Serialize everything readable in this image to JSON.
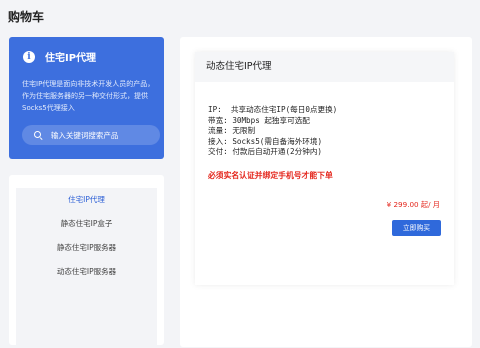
{
  "page": {
    "title": "购物车"
  },
  "hero": {
    "icon": "info-icon",
    "title": "住宅IP代理",
    "description": "住宅IP代理是面向非技术开发人员的产品，作为住宅服务器的另一种交付形式，提供Socks5代理接入",
    "search_placeholder": "输入关键词搜索产品",
    "color": "#3d6fde"
  },
  "categories": [
    {
      "label": "住宅IP代理",
      "active": true
    },
    {
      "label": "静态住宅IP盒子",
      "active": false
    },
    {
      "label": "静态住宅IP服务器",
      "active": false
    },
    {
      "label": "动态住宅IP服务器",
      "active": false
    }
  ],
  "product": {
    "name": "动态住宅IP代理",
    "specs": [
      "IP:  共享动态住宅IP(每日0点更换)",
      "带宽: 30Mbps 起独享可选配",
      "流量: 无限制",
      "接入: Socks5(需自备海外环境)",
      "交付: 付款后自动开通(2分钟内)"
    ],
    "notice": "必须实名认证并绑定手机号才能下单",
    "price": "¥ 299.00 起/ 月",
    "buy_label": "立即购买",
    "accent_color": "#e4261c",
    "button_color": "#2f69db"
  }
}
